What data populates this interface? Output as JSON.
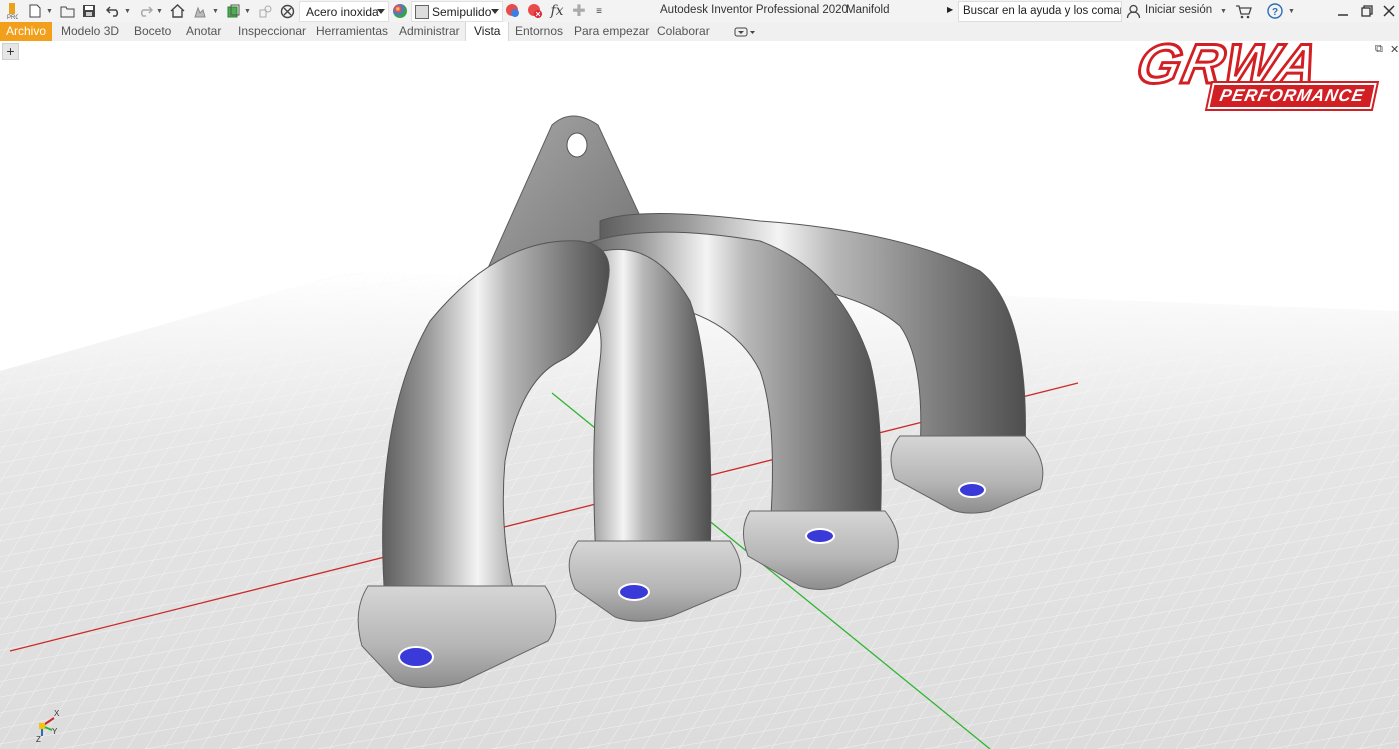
{
  "qat": {
    "material": "Acero inoxida",
    "appearance": "Semipulido",
    "fx_label": "fx"
  },
  "window": {
    "app_title": "Autodesk Inventor Professional 2020",
    "doc_title": "Manifold"
  },
  "search": {
    "placeholder": "Buscar en la ayuda y los comandos"
  },
  "signin_label": "Iniciar sesión",
  "tabs": [
    {
      "label": "Archivo"
    },
    {
      "label": "Modelo 3D"
    },
    {
      "label": "Boceto"
    },
    {
      "label": "Anotar"
    },
    {
      "label": "Inspeccionar"
    },
    {
      "label": "Herramientas"
    },
    {
      "label": "Administrar"
    },
    {
      "label": "Vista"
    },
    {
      "label": "Entornos"
    },
    {
      "label": "Para empezar"
    },
    {
      "label": "Colaborar"
    }
  ],
  "active_tab": "Vista",
  "logo": {
    "word": "GRWA",
    "sub": "PERFORMANCE",
    "color": "#d21f24"
  },
  "axes": {
    "x": "X",
    "y": "Y",
    "z": "Z"
  },
  "colors": {
    "file_tab": "#f29f1b",
    "x_axis": "#cc2a2a",
    "y_axis": "#2fb52f",
    "hole": "#3a3ad8"
  }
}
